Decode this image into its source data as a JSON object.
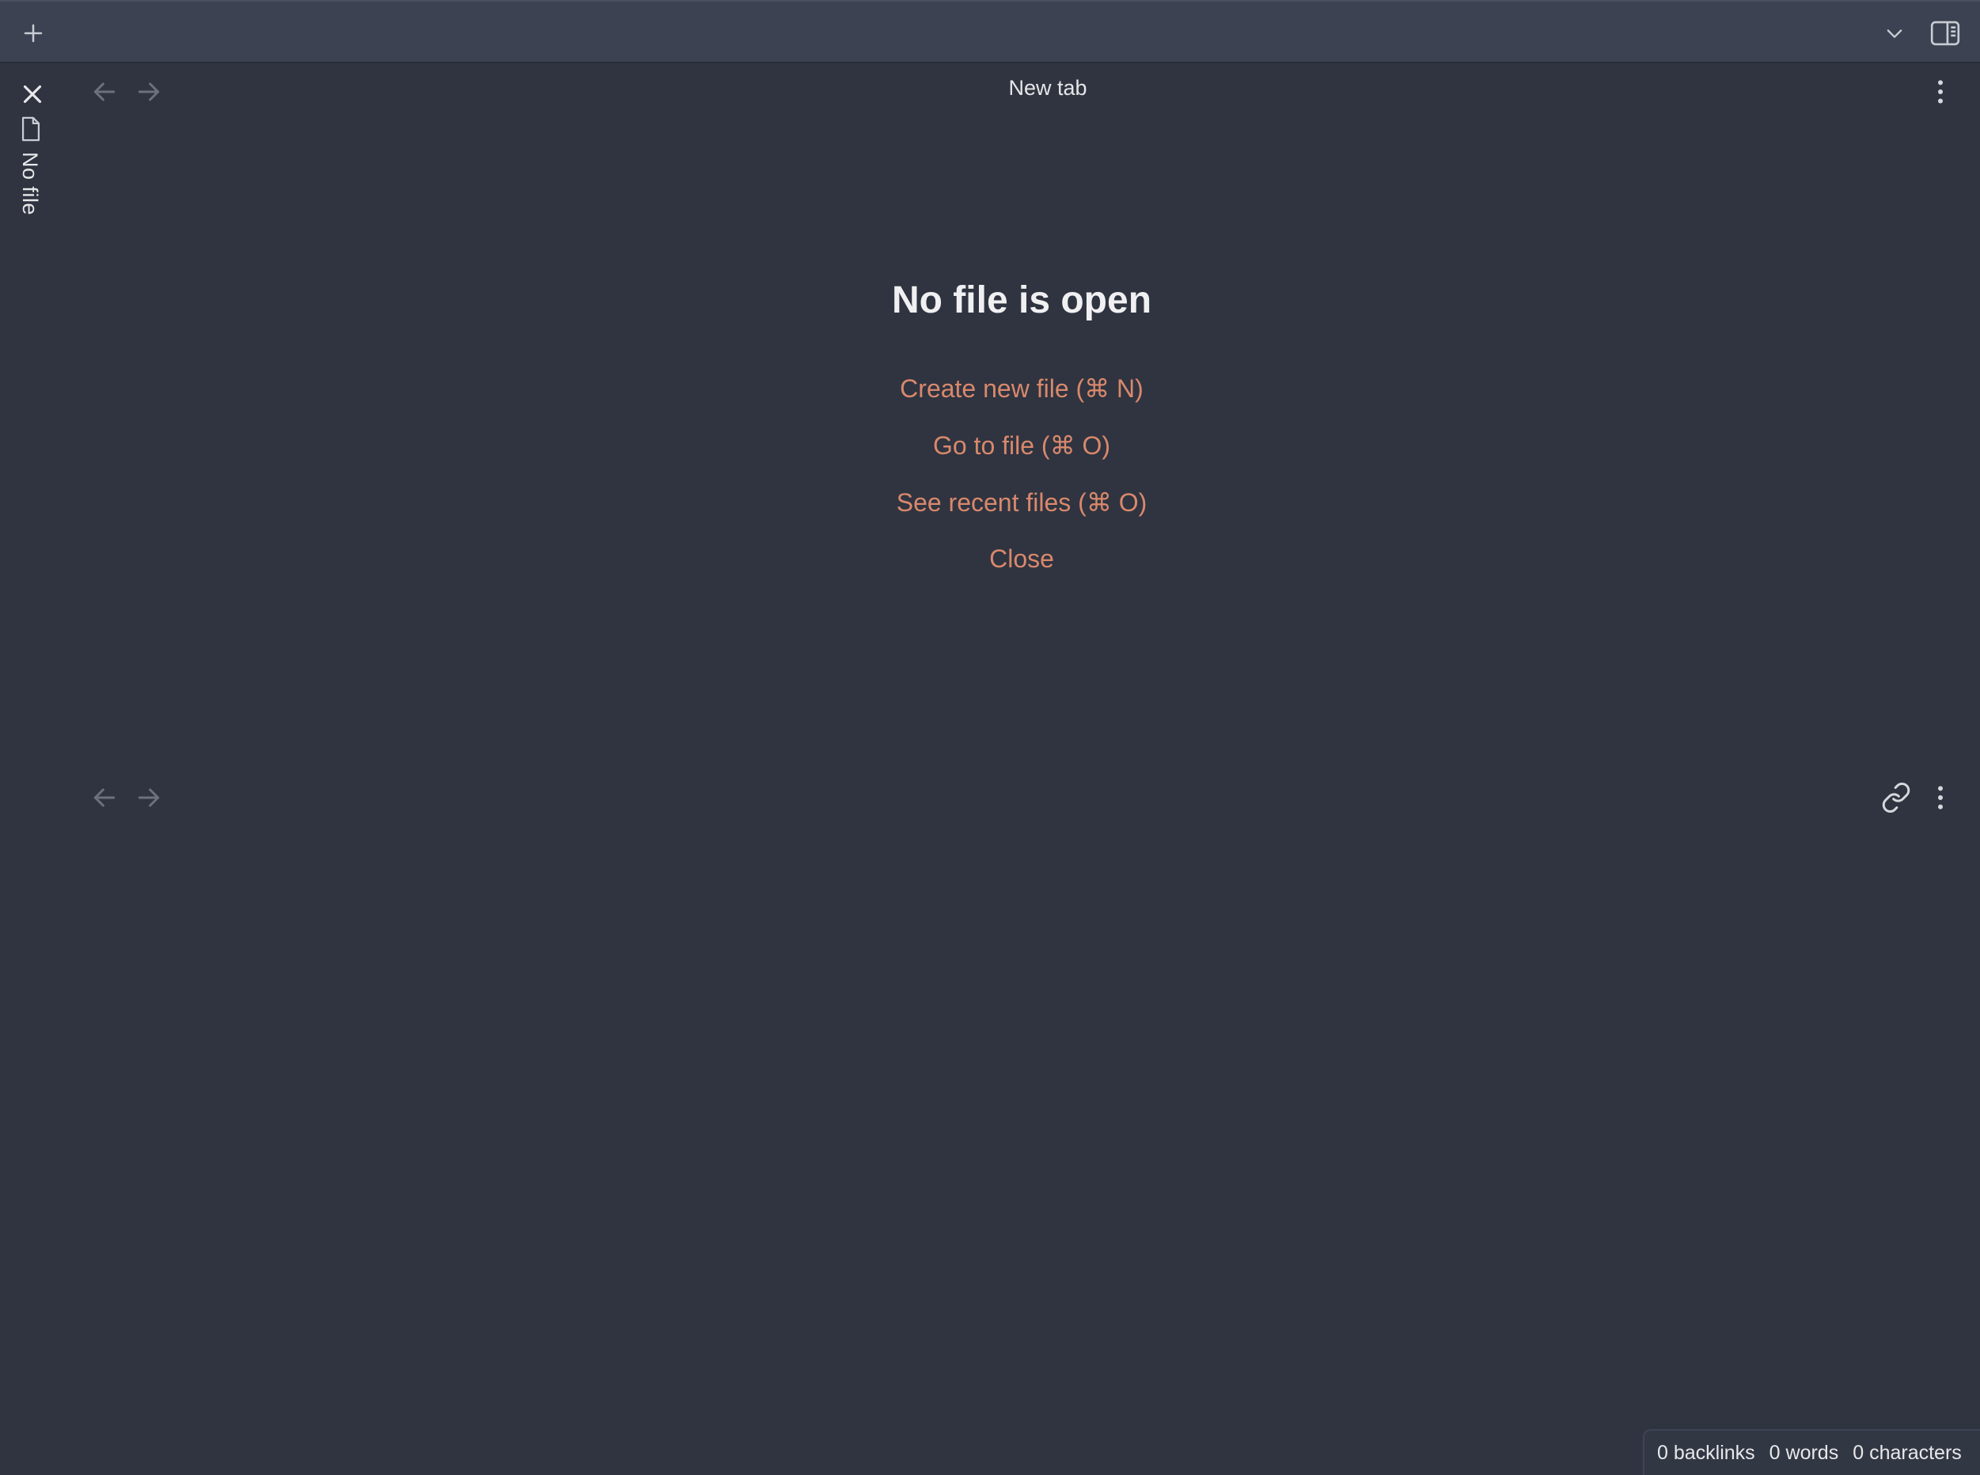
{
  "titlebar": {
    "new_tab_icon": "plus-icon",
    "tab_list_icon": "chevron-down-icon",
    "sidebar_toggle_icon": "sidebar-toggle-icon"
  },
  "sidebar": {
    "close_icon": "close-icon",
    "file_icon": "file-icon",
    "label": "No file"
  },
  "top_pane": {
    "title": "New tab",
    "back_icon": "arrow-left-icon",
    "forward_icon": "arrow-right-icon",
    "more_icon": "more-vertical-icon"
  },
  "empty_state": {
    "heading": "No file is open",
    "actions": [
      {
        "label": "Create new file (⌘ N)"
      },
      {
        "label": "Go to file (⌘ O)"
      },
      {
        "label": "See recent files (⌘ O)"
      },
      {
        "label": "Close"
      }
    ]
  },
  "bottom_pane": {
    "back_icon": "arrow-left-icon",
    "forward_icon": "arrow-right-icon",
    "link_icon": "link-icon",
    "more_icon": "more-vertical-icon"
  },
  "status": {
    "backlinks": "0 backlinks",
    "words": "0 words",
    "characters": "0 characters"
  },
  "colors": {
    "background": "#2f3440",
    "titlebar": "#3c4252",
    "accent": "#d9886c",
    "text": "#f0f0f2"
  }
}
